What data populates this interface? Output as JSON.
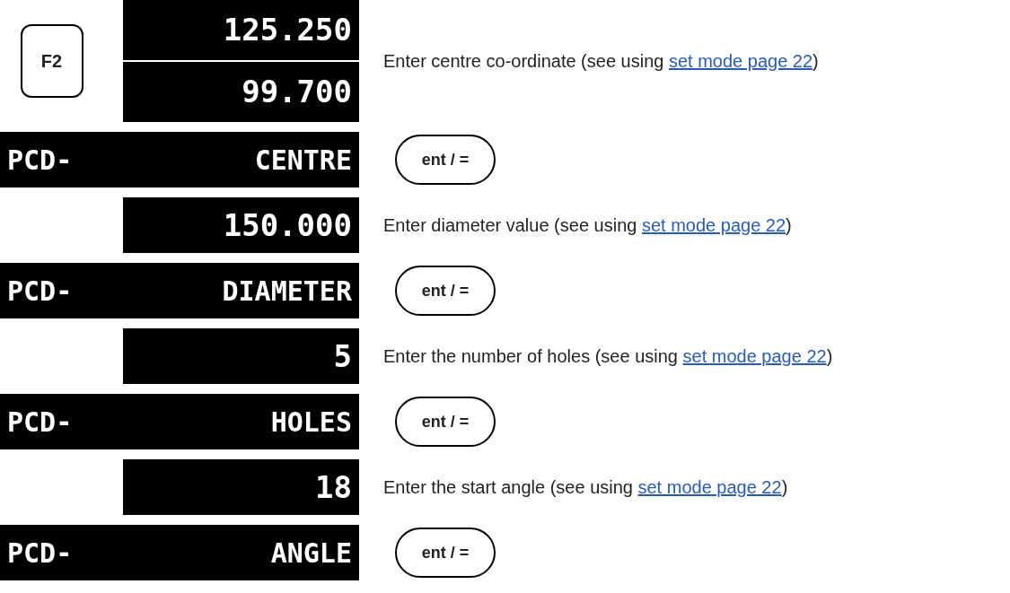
{
  "steps": [
    {
      "key": "F2",
      "readouts": [
        "125.250",
        "99.700"
      ],
      "instruction": "Enter centre co-ordinate (see using ",
      "link": "set mode page 22",
      "instruction_end": ")",
      "prompt": {
        "mode": "PCD-",
        "label": "CENTRE"
      },
      "button": "ent / ="
    },
    {
      "readouts": [
        "150.000"
      ],
      "instruction": "Enter diameter value (see using ",
      "link": "set mode page 22",
      "instruction_end": ")",
      "prompt": {
        "mode": "PCD-",
        "label": "DIAMETER"
      },
      "button": "ent / ="
    },
    {
      "readouts": [
        "5"
      ],
      "instruction": "Enter the number of holes (see using ",
      "link": "set mode page 22",
      "instruction_end": ")",
      "prompt": {
        "mode": "PCD-",
        "label": "HOLES"
      },
      "button": "ent / ="
    },
    {
      "readouts": [
        "18"
      ],
      "instruction": "Enter the start angle (see using ",
      "link": "set mode page 22",
      "instruction_end": ")",
      "prompt": {
        "mode": "PCD-",
        "label": "ANGLE"
      },
      "button": "ent / ="
    }
  ]
}
